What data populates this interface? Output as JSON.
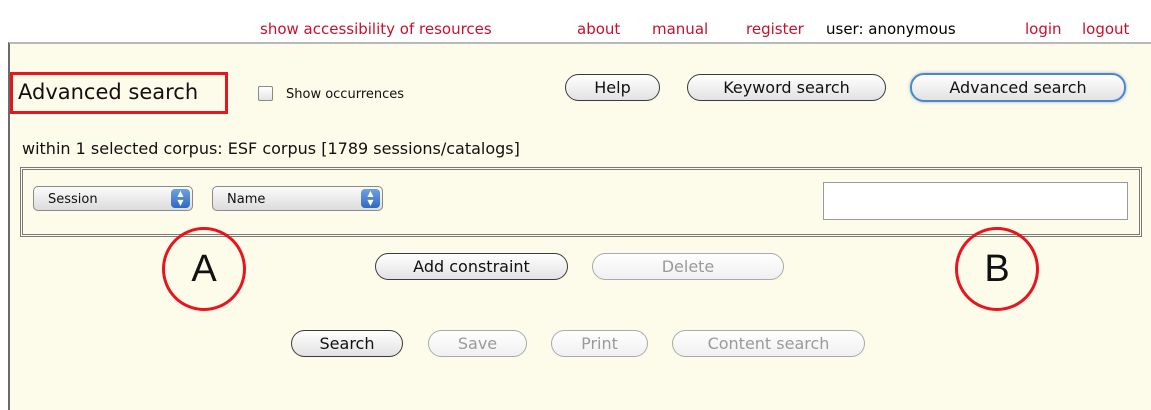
{
  "topnav": {
    "accessibility": "show accessibility of resources",
    "about": "about",
    "manual": "manual",
    "register": "register",
    "user": "user: anonymous",
    "login": "login",
    "logout": "logout"
  },
  "header": {
    "title": "Advanced search",
    "show_occurrences": "Show occurrences",
    "show_occurrences_checked": false,
    "help": "Help",
    "keyword_search": "Keyword search",
    "advanced_search": "Advanced search",
    "active_mode": "Advanced search"
  },
  "corpus_info": "within 1 selected corpus: ESF corpus [1789 sessions/catalogs]",
  "constraint": {
    "field_type": "Session",
    "field_name": "Name",
    "value": ""
  },
  "constraint_actions": {
    "add": "Add constraint",
    "delete": "Delete"
  },
  "annotations": {
    "a": "A",
    "b": "B"
  },
  "bottom_actions": {
    "search": "Search",
    "save": "Save",
    "print": "Print",
    "content_search": "Content search"
  },
  "colors": {
    "link": "#c8102e",
    "panel_bg": "#fdfbe9",
    "annotation": "#e8141e",
    "active_border": "#4f86c6"
  }
}
